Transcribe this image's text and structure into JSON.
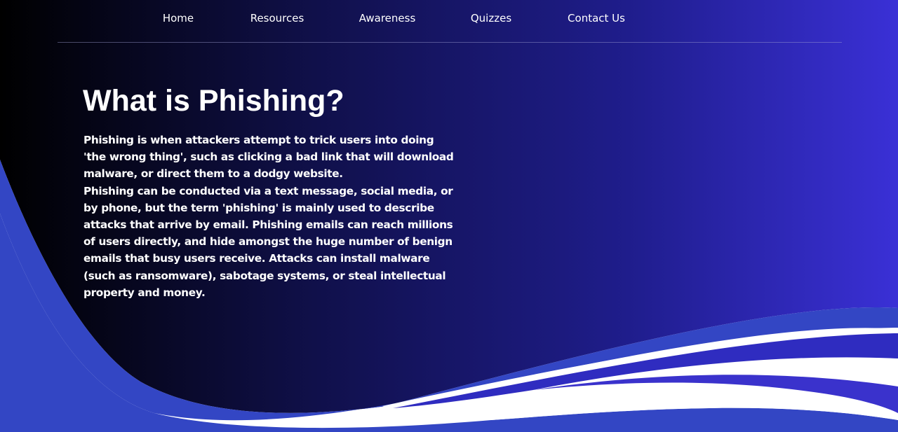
{
  "nav": {
    "items": [
      {
        "label": "Home"
      },
      {
        "label": "Resources"
      },
      {
        "label": "Awareness"
      },
      {
        "label": "Quizzes"
      },
      {
        "label": "Contact Us"
      }
    ]
  },
  "hero": {
    "title": "What is Phishing?",
    "paragraphs": [
      "Phishing is when attackers attempt to trick users into doing 'the wrong thing', such as clicking a bad link that will download malware, or direct them to a dodgy website.",
      "Phishing can be conducted via a text message, social media, or by phone, but the term 'phishing' is mainly used to describe attacks that arrive by email. Phishing emails can reach millions of users directly, and hide amongst the huge number of benign emails that busy users receive. Attacks can install malware (such as ransomware), sabotage systems, or steal intellectual property and money."
    ]
  },
  "colors": {
    "gradient_start": "#000000",
    "gradient_end": "#3a30d6",
    "wave_accent": "#3346c4",
    "text": "#ffffff",
    "page_background": "#ffffff"
  }
}
